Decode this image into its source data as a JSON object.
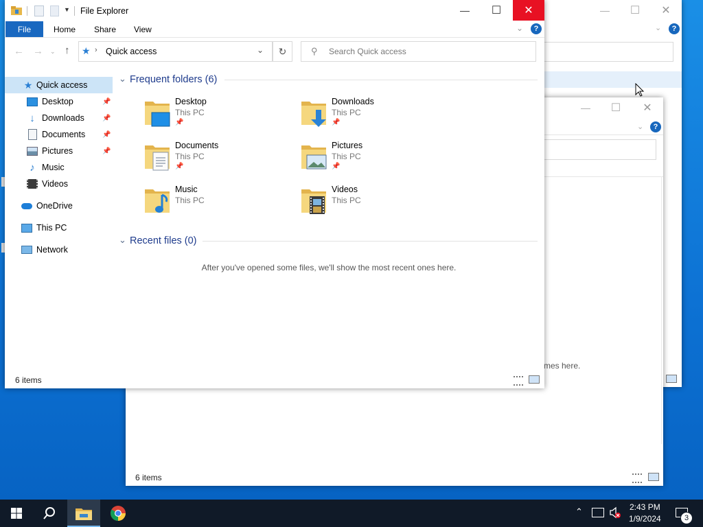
{
  "main_window": {
    "title": "File Explorer",
    "ribbon_tabs": [
      "File",
      "Home",
      "Share",
      "View"
    ],
    "address": "Quick access",
    "search_placeholder": "Search Quick access",
    "sidebar": [
      {
        "label": "Quick access",
        "icon": "star-icon"
      },
      {
        "label": "Desktop",
        "icon": "desktop-icon",
        "pinned": true
      },
      {
        "label": "Downloads",
        "icon": "downloads-icon",
        "pinned": true
      },
      {
        "label": "Documents",
        "icon": "documents-icon",
        "pinned": true
      },
      {
        "label": "Pictures",
        "icon": "pictures-icon",
        "pinned": true
      },
      {
        "label": "Music",
        "icon": "music-icon"
      },
      {
        "label": "Videos",
        "icon": "videos-icon"
      },
      {
        "label": "OneDrive",
        "icon": "onedrive-icon"
      },
      {
        "label": "This PC",
        "icon": "this-pc-icon"
      },
      {
        "label": "Network",
        "icon": "network-icon"
      }
    ],
    "frequent_header": "Frequent folders (6)",
    "folders": [
      {
        "name": "Desktop",
        "location": "This PC",
        "icon": "desktop-folder-icon",
        "pinned": true
      },
      {
        "name": "Downloads",
        "location": "This PC",
        "icon": "downloads-folder-icon",
        "pinned": true
      },
      {
        "name": "Documents",
        "location": "This PC",
        "icon": "documents-folder-icon",
        "pinned": true
      },
      {
        "name": "Pictures",
        "location": "This PC",
        "icon": "pictures-folder-icon",
        "pinned": true
      },
      {
        "name": "Music",
        "location": "This PC",
        "icon": "music-folder-icon",
        "pinned": false
      },
      {
        "name": "Videos",
        "location": "This PC",
        "icon": "videos-folder-icon",
        "pinned": false
      }
    ],
    "recent_header": "Recent files (0)",
    "recent_empty": "After you've opened some files, we'll show the most recent ones here.",
    "status": "6 items"
  },
  "back_window_2": {
    "recent_empty_tail": "mes here.",
    "status": "6 items"
  },
  "taskbar": {
    "time": "2:43 PM",
    "date": "1/9/2024",
    "notification_count": "3"
  },
  "colors": {
    "accent": "#0063b1",
    "close_hover": "#e81123",
    "taskbar": "#101a28"
  }
}
